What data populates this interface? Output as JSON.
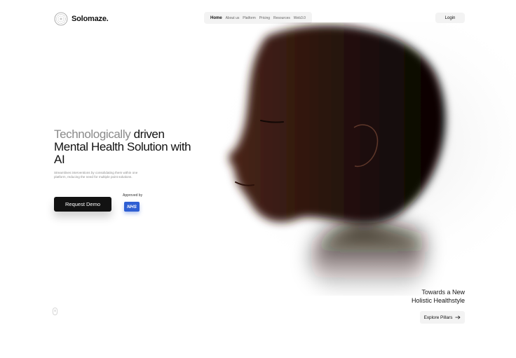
{
  "brand": {
    "name": "Solomaze."
  },
  "nav": {
    "items": [
      {
        "label": "Home",
        "active": true
      },
      {
        "label": "About us",
        "active": false
      },
      {
        "label": "Platform",
        "active": false
      },
      {
        "label": "Pricing",
        "active": false
      },
      {
        "label": "Resources",
        "active": false
      },
      {
        "label": "Web3.0",
        "active": false
      }
    ]
  },
  "header": {
    "login_label": "Login"
  },
  "hero": {
    "headline_part1": "Technologically",
    "headline_part2": "driven Mental Health Solution with AI",
    "description": "Streamlines interventions by consolidating them within one platform, reducing the need for multiple point solutions.",
    "cta_label": "Request Demo",
    "approved_label": "Approved by",
    "nhs_label": "NHS"
  },
  "tagline": {
    "line1_a": "Towards a ",
    "line1_b": "New",
    "line2": "Holistic Healthstyle"
  },
  "explore": {
    "label": "Explore Pillars",
    "icon": "arrow-right-icon"
  },
  "colors": {
    "accent_nhs": "#2f5fd3",
    "button_dark": "#121212",
    "pill_bg": "#f3f3f3"
  }
}
